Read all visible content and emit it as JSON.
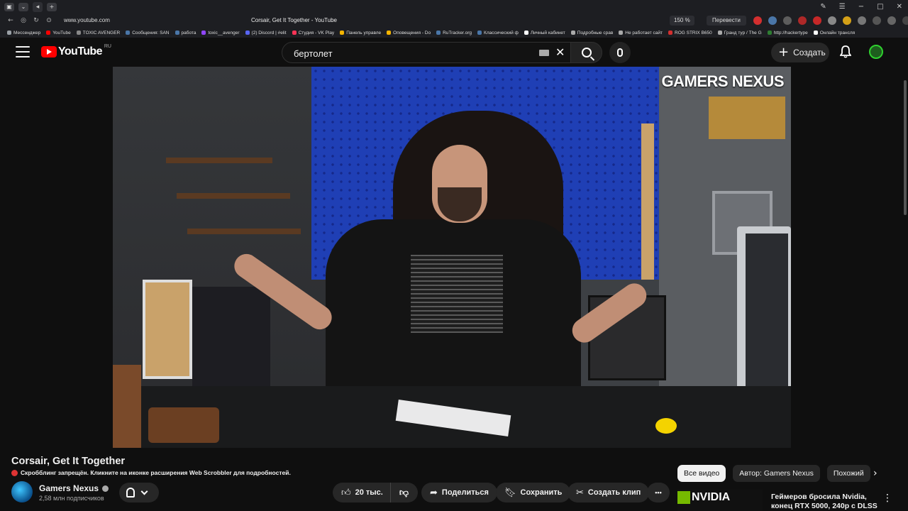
{
  "browser": {
    "url": "www.youtube.com",
    "tab_title": "Corsair, Get It Together - YouTube",
    "zoom": "150 %",
    "translate_label": "Перевести",
    "bookmarks": [
      {
        "label": "Мессенджер",
        "color": "#9aa0a6"
      },
      {
        "label": "YouTube",
        "color": "#ff0000"
      },
      {
        "label": "TOXIC AVENGER",
        "color": "#888888"
      },
      {
        "label": "Сообщения: SAN",
        "color": "#4a76a8"
      },
      {
        "label": "работа",
        "color": "#4a76a8"
      },
      {
        "label": "toxic__avenger",
        "color": "#9146ff"
      },
      {
        "label": "(2) Discord | #elit",
        "color": "#5865f2"
      },
      {
        "label": "Студия - VK Play",
        "color": "#ff3355"
      },
      {
        "label": "Панель управле",
        "color": "#f4b400"
      },
      {
        "label": "Оповещения - Do",
        "color": "#f4b400"
      },
      {
        "label": "RuTracker.org",
        "color": "#4a76a8"
      },
      {
        "label": "Классический ф",
        "color": "#4a76a8"
      },
      {
        "label": "Личный кабинет",
        "color": "#ffffff"
      },
      {
        "label": "Подробные срав",
        "color": "#aaaaaa"
      },
      {
        "label": "Не работает сайт",
        "color": "#aaaaaa"
      },
      {
        "label": "ROG STRIX B650",
        "color": "#d32f2f"
      },
      {
        "label": "Гранд тур / The G",
        "color": "#aaaaaa"
      },
      {
        "label": "http://hackertype",
        "color": "#2e7d32"
      },
      {
        "label": "Онлайн трансля",
        "color": "#ffffff"
      }
    ]
  },
  "header": {
    "logo_text": "YouTube",
    "logo_country": "RU",
    "search_value": "бертолет",
    "create_label": "Создать"
  },
  "video": {
    "overlay_logo": "GAMERS NEXUS",
    "title": "Corsair, Get It Together",
    "scrobbler_notice": "Скробблинг запрещён. Кликните на иконке расширения Web Scrobbler для подробностей."
  },
  "channel": {
    "name": "Gamers Nexus",
    "subscribers": "2,58 млн подписчиков"
  },
  "actions": {
    "likes": "20 тыс.",
    "share": "Поделиться",
    "save": "Сохранить",
    "clip": "Создать клип",
    "more": "•••"
  },
  "chips": [
    {
      "label": "Все видео",
      "active": true
    },
    {
      "label": "Автор: Gamers Nexus",
      "active": false
    },
    {
      "label": "Похожий",
      "active": false
    }
  ],
  "recommendation": {
    "thumb_text": "NVIDIA",
    "title": "Геймеров бросила Nvidia, конец RTX 5000, 240p с DLSS"
  },
  "colors": {
    "background": "#0f0f0f",
    "accent_red": "#ff0000",
    "pill_bg": "#272727",
    "text": "#f1f1f1",
    "subtext": "#aaaaaa"
  }
}
